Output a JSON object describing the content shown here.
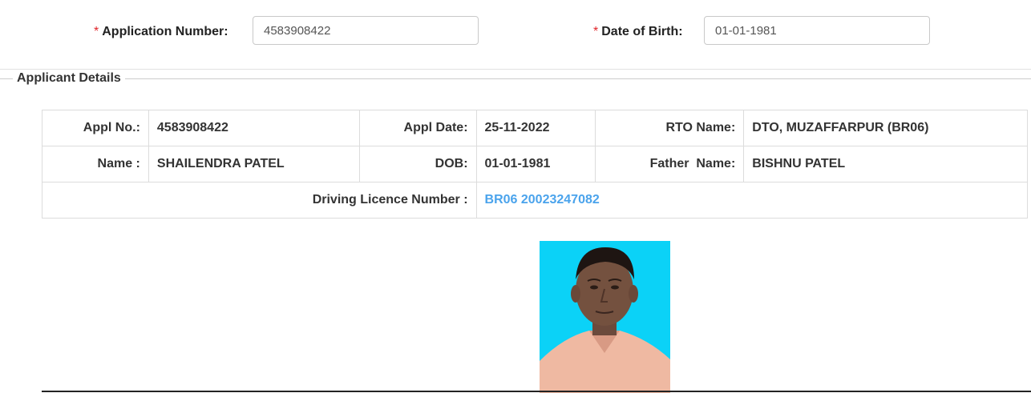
{
  "form": {
    "required_mark": "*",
    "app_number_label": "Application Number:",
    "app_number_value": "4583908422",
    "dob_label": "Date of Birth:",
    "dob_value": "01-01-1981"
  },
  "section": {
    "legend": "Applicant Details"
  },
  "details": {
    "appl_no_label": "Appl No.:",
    "appl_no": "4583908422",
    "appl_date_label": "Appl Date:",
    "appl_date": "25-11-2022",
    "rto_label": "RTO Name:",
    "rto": "DTO, MUZAFFARPUR (BR06)",
    "name_label": "Name :",
    "name": "SHAILENDRA PATEL",
    "dob_label": "DOB:",
    "dob": "01-01-1981",
    "father_label": "Father  Name:",
    "father": "BISHNU PATEL",
    "dl_label": "Driving Licence Number :",
    "dl": "BR06 20023247082"
  },
  "colors": {
    "required": "#e0262b",
    "link": "#4aa3ec",
    "photo_background": "#0bd2f7"
  },
  "icons": {
    "photo": "applicant-photo"
  }
}
